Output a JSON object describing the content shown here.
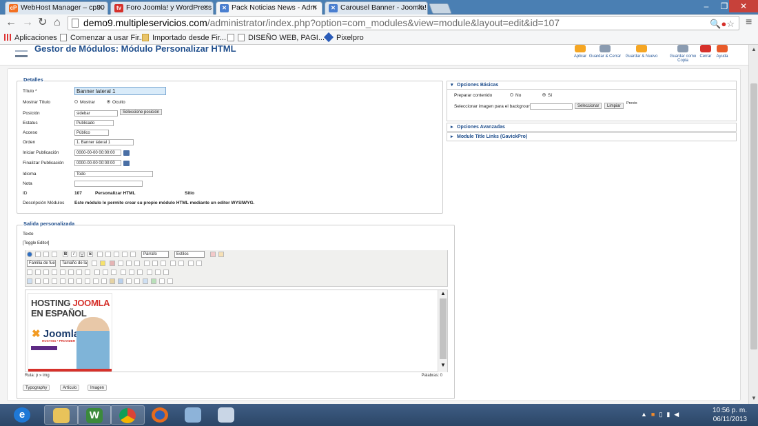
{
  "browser": {
    "tabs": [
      {
        "label": "WebHost Manager – cp80",
        "icon": "cpanel-icon",
        "icon_color": "#f37021",
        "icon_text": "cP"
      },
      {
        "label": "Foro Joomla! y WordPress",
        "icon": "forum-icon",
        "icon_color": "#d6312b",
        "icon_text": "tv"
      },
      {
        "label": "Pack Noticias News - Adm",
        "icon": "joomla-icon",
        "icon_color": "#4a7fd0",
        "icon_text": "✕"
      },
      {
        "label": "Carousel Banner - Joomla!",
        "icon": "joomla-icon",
        "icon_color": "#4a7fd0",
        "icon_text": "✕"
      }
    ],
    "url_domain": "demo9.multipleservicios.com",
    "url_path": "/administrator/index.php?option=com_modules&view=module&layout=edit&id=107",
    "bookmarks": [
      "Aplicaciones",
      "Comenzar a usar Fir...",
      "Importado desde Fir...",
      "DISEÑO WEB, PAGI...",
      "Pixelpro"
    ]
  },
  "page": {
    "title": "Gestor de Módulos: Módulo Personalizar HTML",
    "toolbar": [
      {
        "label": "Aplicar",
        "color": "#f5a623"
      },
      {
        "label": "Guardar & Cerrar",
        "color": "#8a9bb0"
      },
      {
        "label": "Guardar & Nuevo",
        "color": "#f5a623"
      },
      {
        "label": "Guardar como Copia",
        "color": "#8a9bb0"
      },
      {
        "label": "Cerrar",
        "color": "#d6312b"
      },
      {
        "label": "Ayuda",
        "color": "#e85b2a"
      }
    ]
  },
  "details": {
    "legend": "Detalles",
    "titulo_label": "Título *",
    "titulo_value": "Banner lateral 1",
    "mostrar_label": "Mostrar Título",
    "mostrar_opt1": "Mostrar",
    "mostrar_opt2": "Oculto",
    "posicion_label": "Posición",
    "posicion_value": "sidebar",
    "posicion_btn": "Seleccione posición",
    "estatus_label": "Estatus",
    "estatus_value": "Publicado",
    "acceso_label": "Acceso",
    "acceso_value": "Público",
    "orden_label": "Orden",
    "orden_value": "1. Banner lateral 1",
    "inicio_label": "Iniciar Publicación",
    "inicio_value": "0000-00-00 00:00:00",
    "fin_label": "Finalizar Publicación",
    "fin_value": "0000-00-00 00:00:00",
    "idioma_label": "Idioma",
    "idioma_value": "Todo",
    "nota_label": "Nota",
    "nota_value": "",
    "id_label": "ID",
    "id_value": "107",
    "type_value": "Personalizar HTML",
    "site_value": "Sitio",
    "desc_label": "Descripción Módulos",
    "desc_value": "Este módulo le permite crear su propio módulo HTML mediante un editor WYSIWYG."
  },
  "options": {
    "basic_title": "Opciones Básicas",
    "preparar_label": "Preparar contenido",
    "preparar_no": "No",
    "preparar_si": "Sí",
    "imagen_label": "Seleccionar imagen para el background",
    "imagen_value": "",
    "select_btn": "Seleccionar",
    "clear_btn": "Limpiar",
    "preview_label": "Previo",
    "advanced_title": "Opciones Avanzadas",
    "title_links": "Module Title Links (GavickPro)"
  },
  "custom_output": {
    "legend": "Salida personalizada",
    "text_label": "Texto",
    "toggle_editor": "[Toggle Editor]",
    "format_select": "Párrafo",
    "styles_select": "Estilos",
    "font_select": "Familia de fue",
    "size_select": "Tamaño de la",
    "banner": {
      "line1_a": "HOSTING ",
      "line1_b": "JOOMLA",
      "line2": "EN ESPAÑOL",
      "brand": "Joomla!",
      "sub": "HOSTING • PROVIDER"
    },
    "path_label": "Ruta: p » img",
    "words_label": "Palabras: 0",
    "btn_typography": "Typography",
    "btn_article": "Artículo",
    "btn_image": "Imagen"
  },
  "taskbar": {
    "time": "10:56 p. m.",
    "date": "06/11/2013"
  }
}
